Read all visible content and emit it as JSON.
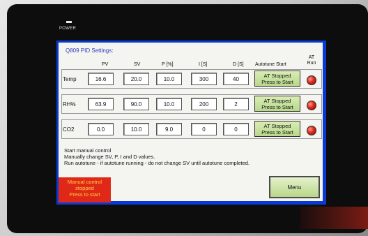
{
  "device": {
    "power_label": "POWER"
  },
  "screen": {
    "title": "Q809 PID Settings:",
    "columns": {
      "pv": "PV",
      "sv": "SV",
      "p": "P [%]",
      "i": "I [S]",
      "d": "D [S]",
      "autotune": "Autotune Start",
      "at_run": "AT Run"
    },
    "rows": [
      {
        "label": "Temp",
        "pv": "16.6",
        "sv": "20.0",
        "p": "10.0",
        "i": "300",
        "d": "40",
        "at_line1": "AT Stopped",
        "at_line2": "Press to Start"
      },
      {
        "label": "RH%",
        "pv": "63.9",
        "sv": "90.0",
        "p": "10.0",
        "i": "200",
        "d": "2",
        "at_line1": "AT Stopped",
        "at_line2": "Press to Start"
      },
      {
        "label": "CO2",
        "pv": "0.0",
        "sv": "10.0",
        "p": "9.0",
        "i": "0",
        "d": "0",
        "at_line1": "AT Stopped",
        "at_line2": "Press to Start"
      }
    ],
    "info": {
      "line1": "Start manual control",
      "line2": "Manually change SV, P, I and D values.",
      "line3": "Run autotune - if autotune running - do not change SV until autotune completed."
    },
    "manual_button": {
      "line1": "Manual control",
      "line2": "stopped",
      "line3": "Press to start"
    },
    "menu_button": "Menu",
    "colors": {
      "screen_border": "#0a3ad6",
      "title": "#2e3fbf",
      "at_button": "#c6e19b",
      "led": "#e0281c",
      "manual_bg": "#e02818",
      "manual_text": "#ffd23c"
    }
  }
}
